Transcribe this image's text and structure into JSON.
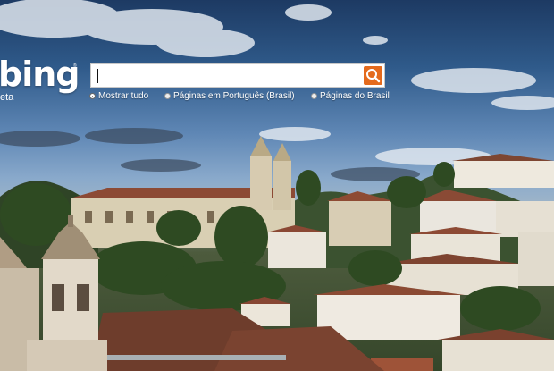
{
  "branding": {
    "logo_text": "bing",
    "beta_label": "eta"
  },
  "search": {
    "value": "",
    "placeholder": ""
  },
  "scopes": [
    {
      "label": "Mostrar tudo",
      "selected": true
    },
    {
      "label": "Páginas em Português (Brasil)",
      "selected": false
    },
    {
      "label": "Páginas do Brasil",
      "selected": false
    }
  ],
  "colors": {
    "search_button": "#e46a1c",
    "sky_top": "#1d3a63",
    "sky_horizon": "#9bb3c9"
  },
  "icons": {
    "search_button": "magnifier-icon"
  }
}
